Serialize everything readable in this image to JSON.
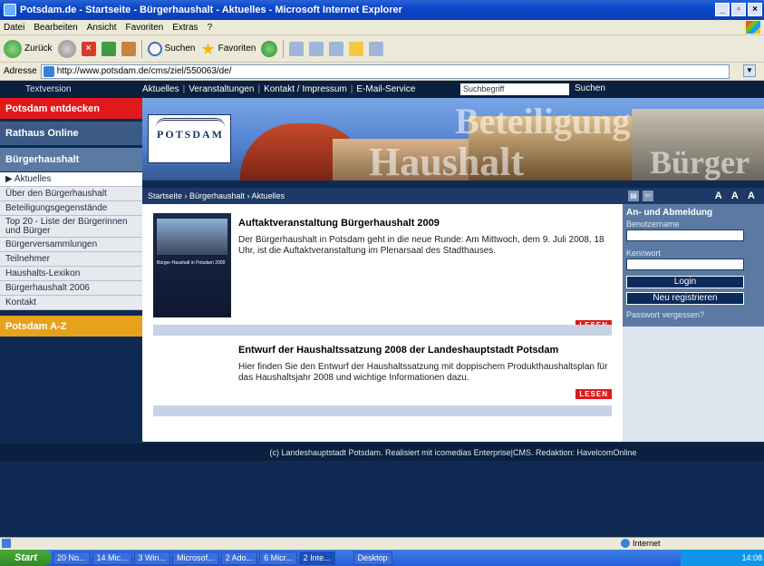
{
  "window": {
    "title": "Potsdam.de - Startseite - Bürgerhaushalt - Aktuelles - Microsoft Internet Explorer",
    "minimize": "_",
    "maximize": "▫",
    "close": "×"
  },
  "menu": [
    "Datei",
    "Bearbeiten",
    "Ansicht",
    "Favoriten",
    "Extras",
    "?"
  ],
  "toolbar": {
    "back_label": "Zurück",
    "search_label": "Suchen",
    "favorites_label": "Favoriten"
  },
  "address": {
    "label": "Adresse",
    "url": "http://www.potsdam.de/cms/ziel/550063/de/"
  },
  "topnav": {
    "textversion": "Textversion",
    "links": [
      "Aktuelles",
      "Veranstaltungen",
      "Kontakt / Impressum",
      "E-Mail-Service"
    ],
    "separator": "|",
    "search_placeholder": "Suchbegriff",
    "search_button": "Suchen"
  },
  "sidebar": {
    "section1": "Potsdam entdecken",
    "section2": "Rathaus Online",
    "section3": "Bürgerhaushalt",
    "items": [
      "▶ Aktuelles",
      "Über den Bürgerhaushalt",
      "Beteiligungsgegenstände",
      "Top 20 - Liste der Bürgerinnen und Bürger",
      "Bürgerversammlungen",
      "Teilnehmer",
      "Haushalts-Lexikon",
      "Bürgerhaushalt 2006",
      "Kontakt"
    ],
    "section4": "Potsdam A-Z"
  },
  "banner": {
    "logo_text": "POTSDAM",
    "word1": "Haushalt",
    "word2": "Beteiligung",
    "word3": "Bürger"
  },
  "breadcrumb": "Startseite › Bürgerhaushalt › Aktuelles",
  "news": [
    {
      "title": "Auftaktveranstaltung Bürgerhaushalt 2009",
      "text": "Der Bürgerhaushalt in Potsdam geht in die neue Runde: Am Mittwoch, dem 9. Juli 2008, 18 Uhr, ist die Auftaktveranstaltung im Plenarsaal des Stadthauses.",
      "thumb_text": "Bürger-Haushalt in Potsdam 2009",
      "more": "LESEN"
    },
    {
      "title": "Entwurf der Haushaltssatzung 2008 der Landeshauptstadt Potsdam",
      "text": "Hier finden Sie den Entwurf der Haushaltssatzung mit doppischem Produkthaushaltsplan für das Haushaltsjahr 2008 und wichtige Informationen dazu.",
      "more": "LESEN"
    }
  ],
  "rightcol": {
    "fontsize_label": "A A A",
    "login_heading": "An- und Abmeldung",
    "username_label": "Benutzername",
    "password_label": "Kennwort",
    "login_button": "Login",
    "register_button": "Neu registrieren",
    "forgot": "Passwort vergessen?"
  },
  "footer": "(c) Landeshauptstadt Potsdam. Realisiert mit icomedias Enterprise|CMS. Redaktion: HavelcomOnline",
  "status": {
    "zone": "Internet"
  },
  "taskbar": {
    "start": "Start",
    "tasks": [
      "20 No...",
      "14 Mic...",
      "3 Win...",
      "Microsof...",
      "2 Ado...",
      "6 Micr...",
      "2 Inte...",
      "Desktop"
    ],
    "clock": "14:08"
  }
}
